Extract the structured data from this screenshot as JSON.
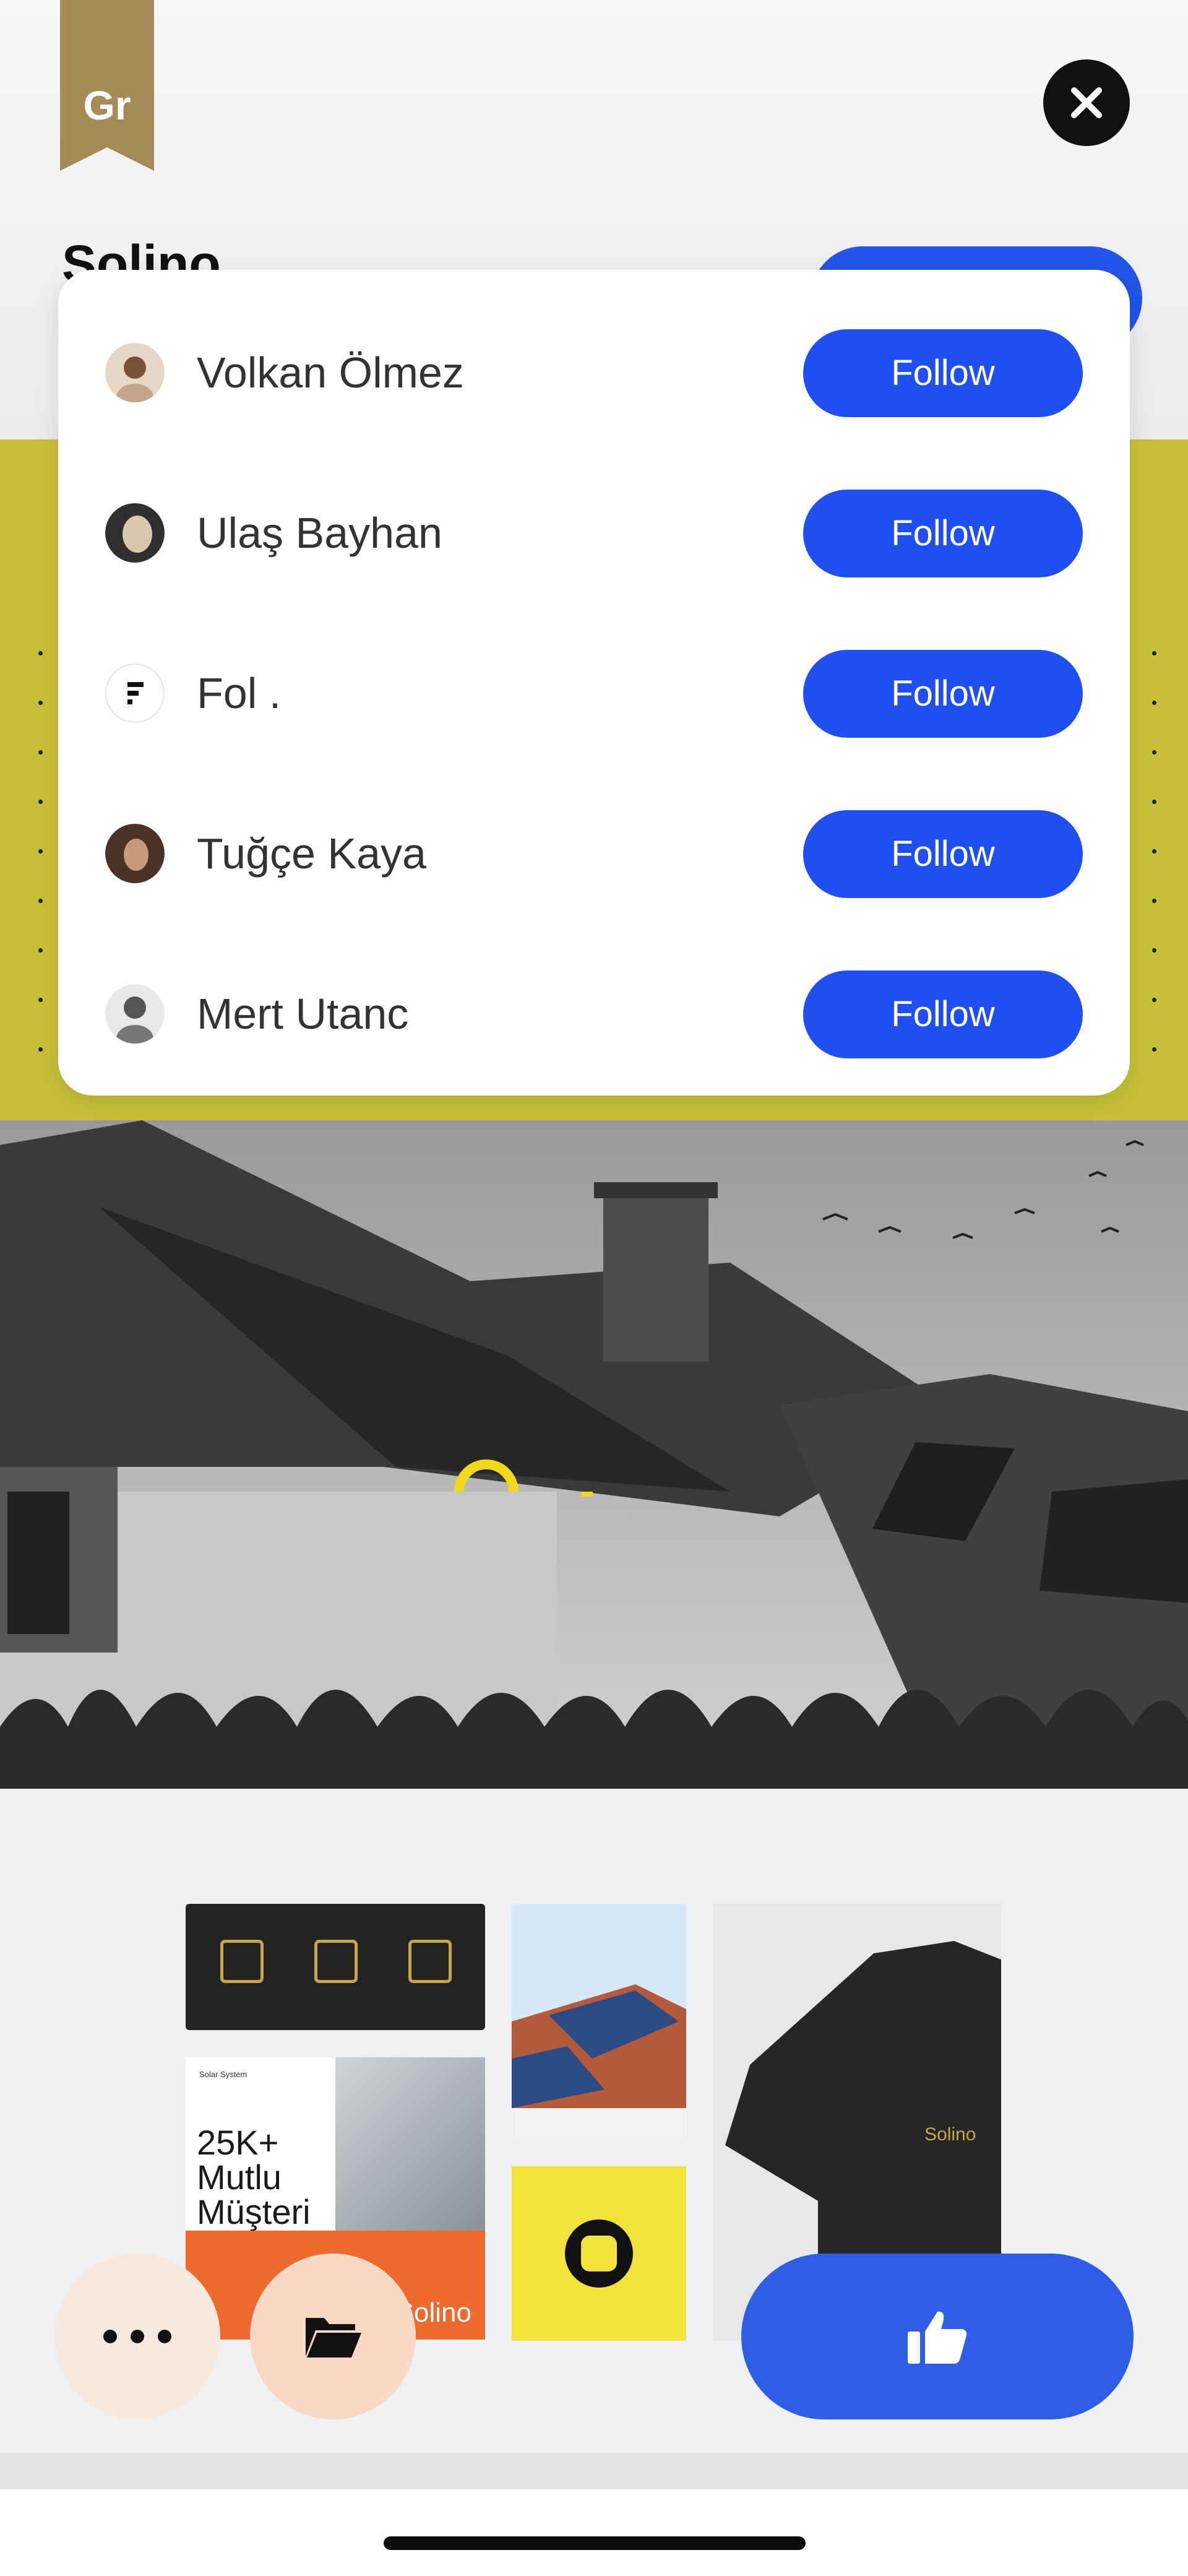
{
  "header": {
    "ribbon_label": "Gr",
    "project_title": "Solino"
  },
  "gallery": {
    "poster_small_text": "Solar System",
    "poster_headline_1": "25K+",
    "poster_headline_2": "Mutlu",
    "poster_headline_3": "Müşteri",
    "poster_brand": "Solino",
    "shirt_brand": "Solino"
  },
  "popover": {
    "users": [
      {
        "name": "Volkan Ölmez",
        "follow_label": "Follow"
      },
      {
        "name": "Ulaş Bayhan",
        "follow_label": "Follow"
      },
      {
        "name": "Fol .",
        "follow_label": "Follow"
      },
      {
        "name": "Tuğçe Kaya",
        "follow_label": "Follow"
      },
      {
        "name": "Mert Utanc",
        "follow_label": "Follow"
      }
    ]
  },
  "colors": {
    "accent_blue": "#1f4ff0",
    "ribbon_gold": "#a58b55",
    "band_yellow": "#c8c03a"
  },
  "icons": {
    "close": "close-icon",
    "more": "more-dots-icon",
    "folder": "folder-icon",
    "like": "thumbs-up-icon"
  }
}
